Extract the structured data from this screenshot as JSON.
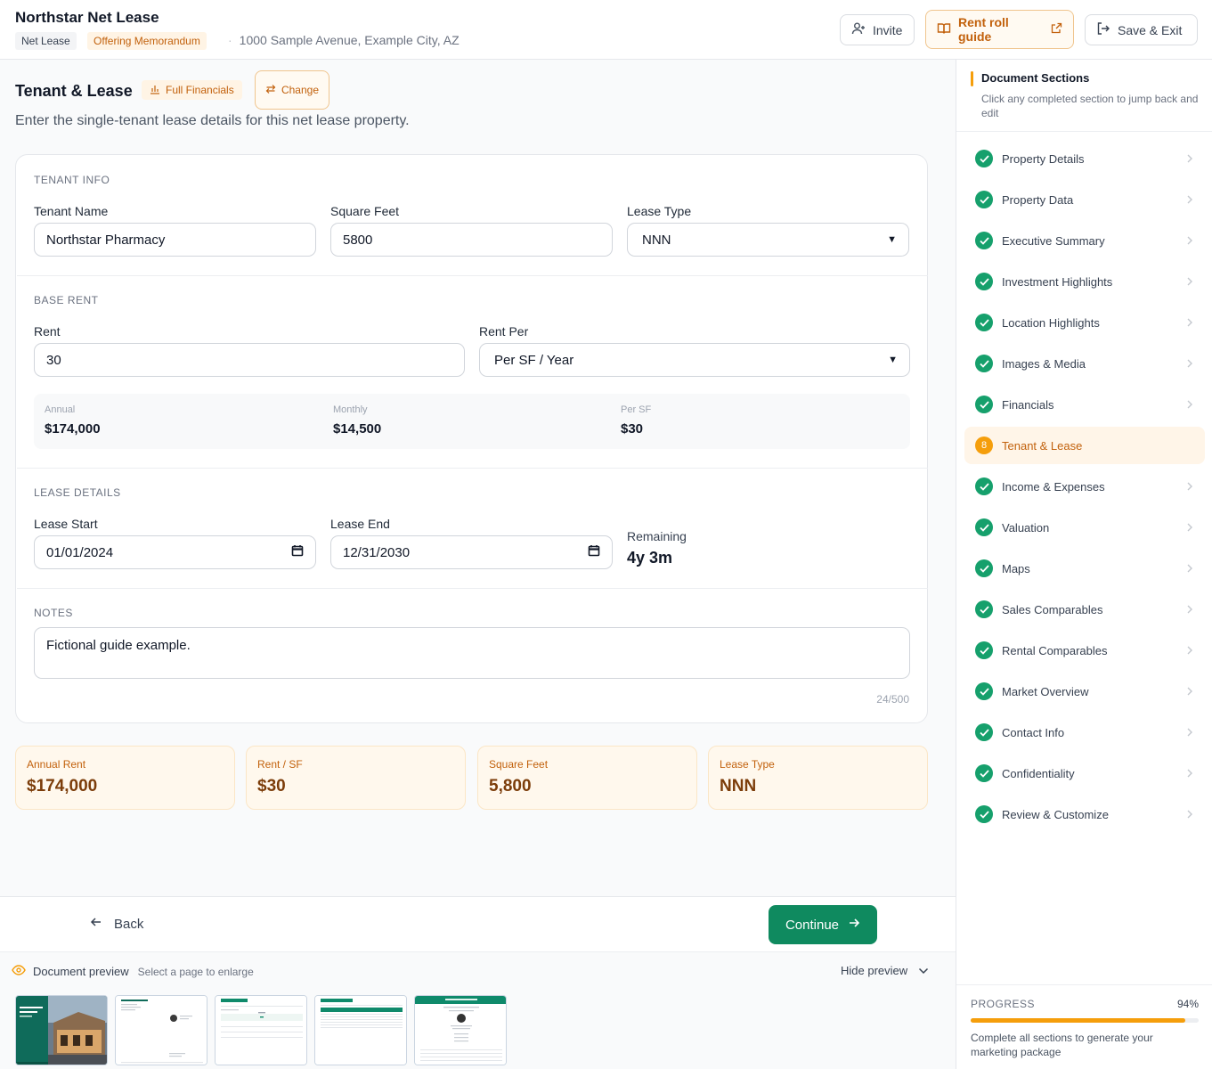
{
  "header": {
    "title": "Northstar Net Lease",
    "tag_type": "Net Lease",
    "tag_doc": "Offering Memorandum",
    "address": "1000 Sample Avenue, Example City, AZ",
    "invite_label": "Invite",
    "guide_label": "Rent roll guide",
    "save_label": "Save & Exit"
  },
  "section": {
    "title": "Tenant & Lease",
    "full_financials_label": "Full Financials",
    "change_label": "Change",
    "description": "Enter the single-tenant lease details for this net lease property."
  },
  "tenant_info": {
    "group_label": "TENANT INFO",
    "tenant_name_label": "Tenant Name",
    "tenant_name_value": "Northstar Pharmacy",
    "sqft_label": "Square Feet",
    "sqft_value": "5800",
    "lease_type_label": "Lease Type",
    "lease_type_value": "NNN"
  },
  "base_rent": {
    "group_label": "BASE RENT",
    "rent_label": "Rent",
    "rent_value": "30",
    "rent_per_label": "Rent Per",
    "rent_per_value": "Per SF / Year",
    "annual_label": "Annual",
    "annual_value": "$174,000",
    "monthly_label": "Monthly",
    "monthly_value": "$14,500",
    "persf_label": "Per SF",
    "persf_value": "$30"
  },
  "lease_details": {
    "group_label": "LEASE DETAILS",
    "start_label": "Lease Start",
    "start_value": "01/01/2024",
    "end_label": "Lease End",
    "end_value": "12/31/2030",
    "remaining_label": "Remaining",
    "remaining_value": "4y 3m"
  },
  "notes": {
    "group_label": "NOTES",
    "value": "Fictional guide example.",
    "counter": "24/500"
  },
  "summary": [
    {
      "label": "Annual Rent",
      "value": "$174,000"
    },
    {
      "label": "Rent / SF",
      "value": "$30"
    },
    {
      "label": "Square Feet",
      "value": "5,800"
    },
    {
      "label": "Lease Type",
      "value": "NNN"
    }
  ],
  "nav": {
    "back_label": "Back",
    "continue_label": "Continue"
  },
  "preview": {
    "title": "Document preview",
    "subtitle": "Select a page to enlarge",
    "hide_label": "Hide preview"
  },
  "sidebar": {
    "title": "Document Sections",
    "description": "Click any completed section to jump back and edit",
    "items": [
      {
        "label": "Property Details",
        "state": "done"
      },
      {
        "label": "Property Data",
        "state": "done"
      },
      {
        "label": "Executive Summary",
        "state": "done"
      },
      {
        "label": "Investment Highlights",
        "state": "done"
      },
      {
        "label": "Location Highlights",
        "state": "done"
      },
      {
        "label": "Images & Media",
        "state": "done"
      },
      {
        "label": "Financials",
        "state": "done"
      },
      {
        "label": "Tenant & Lease",
        "state": "active",
        "number": "8"
      },
      {
        "label": "Income & Expenses",
        "state": "done"
      },
      {
        "label": "Valuation",
        "state": "done"
      },
      {
        "label": "Maps",
        "state": "done"
      },
      {
        "label": "Sales Comparables",
        "state": "done"
      },
      {
        "label": "Rental Comparables",
        "state": "done"
      },
      {
        "label": "Market Overview",
        "state": "done"
      },
      {
        "label": "Contact Info",
        "state": "done"
      },
      {
        "label": "Confidentiality",
        "state": "done"
      },
      {
        "label": "Review & Customize",
        "state": "done"
      }
    ],
    "progress_label": "PROGRESS",
    "progress_value": "94%",
    "progress_fraction": 0.94,
    "progress_desc": "Complete all sections to generate your marketing package"
  },
  "colors": {
    "accent": "#f59e0b",
    "accent_text": "#c2610c",
    "success": "#16a06c",
    "primary_button": "#0f8a5f"
  }
}
